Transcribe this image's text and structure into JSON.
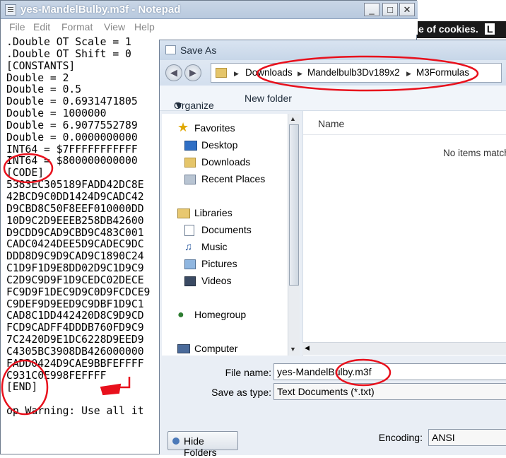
{
  "notepad": {
    "title": "yes-MandelBulby.m3f - Notepad",
    "menu": [
      "File",
      "Edit",
      "Format",
      "View",
      "Help"
    ],
    "lines": [
      ".Double OT Scale = 1",
      ".Double OT Shift = 0",
      "[CONSTANTS]",
      "Double = 2",
      "Double = 0.5",
      "Double = 0.6931471805",
      "Double = 1000000",
      "Double = 6.9077552789",
      "Double = 0.0000000000",
      "INT64 = $7FFFFFFFFFFF",
      "INT64 = $800000000000",
      "[CODE]",
      "5383EC305189FADD42DC8E",
      "42BCD9C0DD1424D9CADC42",
      "D9CBD8C50F8EEF010000DD",
      "10D9C2D9EEEB258DB42600",
      "D9CDD9CAD9CBD9C483C001",
      "CADC0424DEE5D9CADEC9DC",
      "DDD8D9C9D9CAD9C1890C24",
      "C1D9F1D9E8DD02D9C1D9C9",
      "C2D9C9D9F1D9CEDC02DECE",
      "FC9D9F1DEC9D9C0D9FCDCE9",
      "C9DEF9D9EED9C9DBF1D9C1",
      "CAD8C1DD442420D8C9D9CD",
      "FCD9CADFF4DDDB760FD9C9",
      "7C2420D9E1DC6228D9EED9",
      "C4305BC3908DB426000000",
      "FADD0424D9CAE9BBFEFFFF",
      "C931C0E998FEFFFF",
      "[END]",
      "",
      "op Warning: Use all it"
    ]
  },
  "cookie_bar": {
    "text": "e of cookies.",
    "badge": "L"
  },
  "dialog": {
    "title": "Save As",
    "breadcrumb": [
      "Downloads",
      "Mandelbulb3Dv189x2",
      "M3Formulas"
    ],
    "organize_label": "Organize",
    "new_folder_label": "New folder",
    "nav": {
      "favorites": "Favorites",
      "desktop": "Desktop",
      "downloads": "Downloads",
      "recent": "Recent Places",
      "libraries": "Libraries",
      "documents": "Documents",
      "music": "Music",
      "pictures": "Pictures",
      "videos": "Videos",
      "homegroup": "Homegroup",
      "computer": "Computer"
    },
    "column_name": "Name",
    "empty_text": "No items match",
    "file_name_label": "File name:",
    "file_name_value": "yes-MandelBulby.m3f",
    "save_type_label": "Save as type:",
    "save_type_value": "Text Documents (*.txt)",
    "hide_folders_label": "Hide Folders",
    "encoding_label": "Encoding:",
    "encoding_value": "ANSI"
  },
  "colors": {
    "annotation": "#e8101c",
    "title_bar": "#c9d6e6"
  }
}
